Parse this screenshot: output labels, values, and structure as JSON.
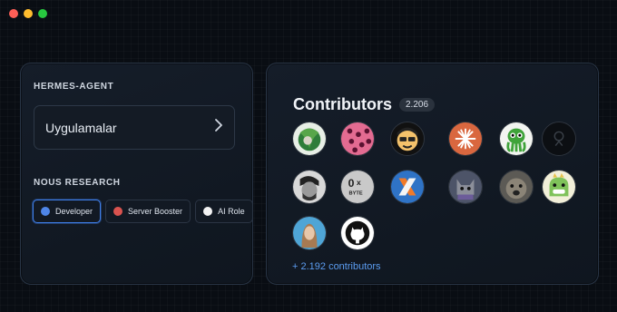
{
  "window": {
    "controls": [
      "close",
      "minimize",
      "maximize"
    ]
  },
  "left_card": {
    "section1_label": "HERMES-AGENT",
    "app_selector_label": "Uygulamalar",
    "section2_label": "NOUS RESEARCH",
    "roles": [
      {
        "label": "Developer",
        "color": "#4f86e8",
        "active": true
      },
      {
        "label": "Server Booster",
        "color": "#d9534f",
        "active": false
      },
      {
        "label": "AI Role",
        "color": "#f2f2f2",
        "active": false
      }
    ]
  },
  "right_card": {
    "title": "Contributors",
    "count": "2.206",
    "more_link": "+ 2.192 contributors",
    "avatars": [
      {
        "icon": "avatar-plant-icon"
      },
      {
        "icon": "avatar-pattern-icon"
      },
      {
        "icon": "avatar-emoji-face-icon"
      },
      {
        "icon": "avatar-asterisk-logo-icon"
      },
      {
        "icon": "avatar-green-octopus-icon"
      },
      {
        "icon": "avatar-dark-icon"
      },
      {
        "icon": "avatar-bw-photo-icon"
      },
      {
        "icon": "avatar-0x-logo-icon"
      },
      {
        "icon": "avatar-x-logo-icon"
      },
      {
        "icon": "avatar-cat-photo-icon"
      },
      {
        "icon": "avatar-dog-photo-icon"
      },
      {
        "icon": "avatar-dinosaur-icon"
      },
      {
        "icon": "avatar-portrait-photo-icon"
      },
      {
        "icon": "avatar-github-icon"
      }
    ]
  },
  "colors": {
    "accent_link": "#5b9cf0",
    "active_border": "#3f7ee8"
  }
}
